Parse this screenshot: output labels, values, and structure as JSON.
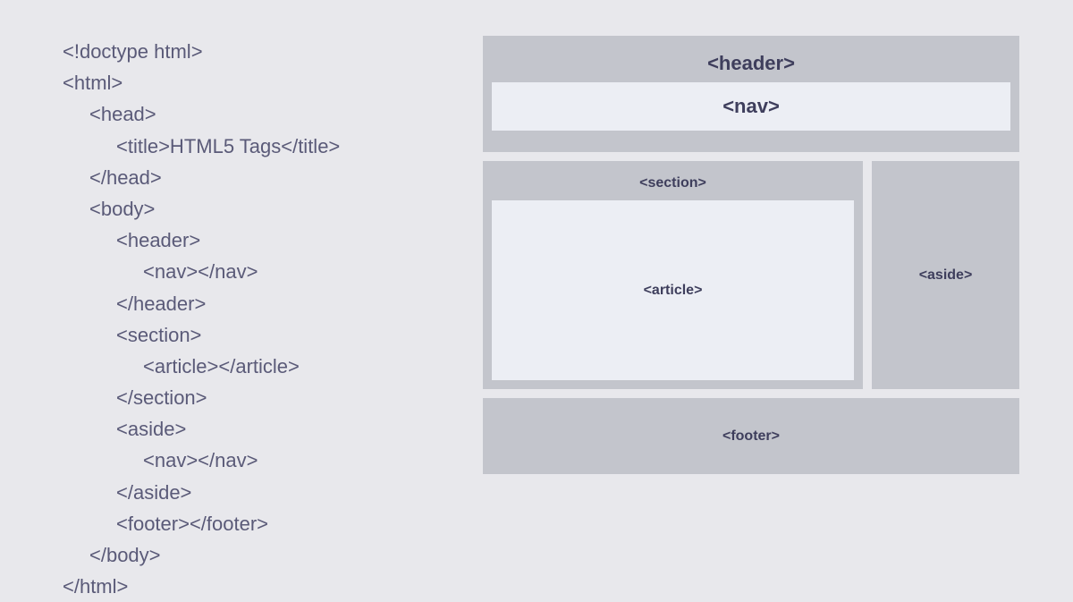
{
  "code": {
    "line1": "<!doctype html>",
    "line2": "<html>",
    "line3": "<head>",
    "line4": "<title>HTML5 Tags</title>",
    "line5": "</head>",
    "line6": "<body>",
    "line7": "<header>",
    "line8": "<nav></nav>",
    "line9": "</header>",
    "line10": "<section>",
    "line11": "<article></article>",
    "line12": "</section>",
    "line13": "<aside>",
    "line14": "<nav></nav>",
    "line15": "</aside>",
    "line16": "<footer></footer>",
    "line17": "</body>",
    "line18": "</html>"
  },
  "layout": {
    "header": "<header>",
    "nav": "<nav>",
    "section": "<section>",
    "article": "<article>",
    "aside": "<aside>",
    "footer": "<footer>"
  }
}
